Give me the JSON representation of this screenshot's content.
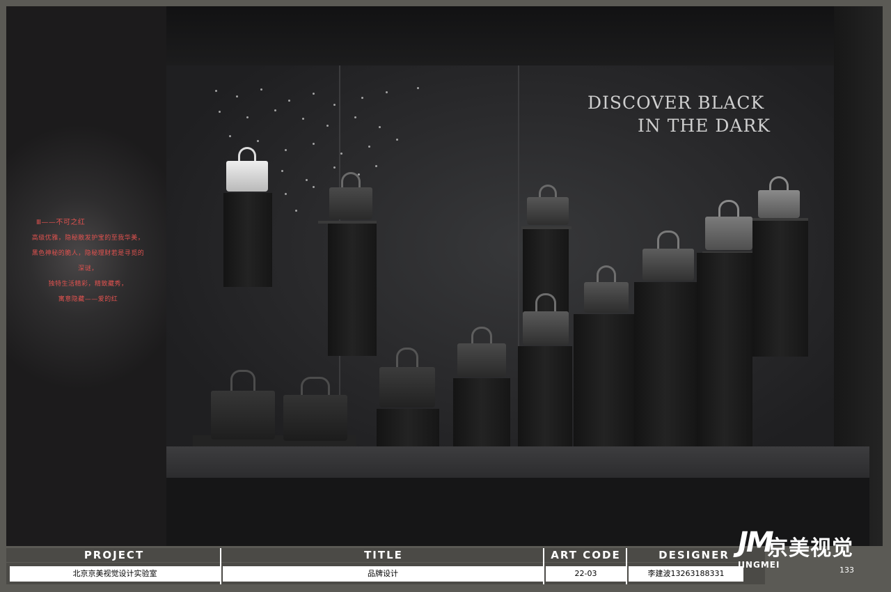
{
  "scene": {
    "slogan_line1": "DISCOVER BLACK",
    "slogan_line2": "IN THE DARK",
    "wall_text_title": "Ⅲ——不可之红",
    "wall_text_lines": [
      "高级优雅，隐秘散发护宝的至我华美，",
      "黑色神秘的脆人，隐秘理财若是寻觅的深谜，",
      "独特生活精彩，精致藏秀，",
      "寓意隐藏——爱的红"
    ]
  },
  "info_bar": {
    "project_label": "PROJECT",
    "title_label": "TITLE",
    "art_code_label": "ART CODE",
    "designer_label": "DESIGNER",
    "project_value": "北京京美视觉设计实验室",
    "title_value": "品牌设计",
    "art_code_value": "22-03",
    "designer_value": "李建波13263188331"
  },
  "logo": {
    "mark": "JM",
    "name_cn": "京美视觉",
    "name_en": "JINGMEI"
  },
  "page_number": "133"
}
